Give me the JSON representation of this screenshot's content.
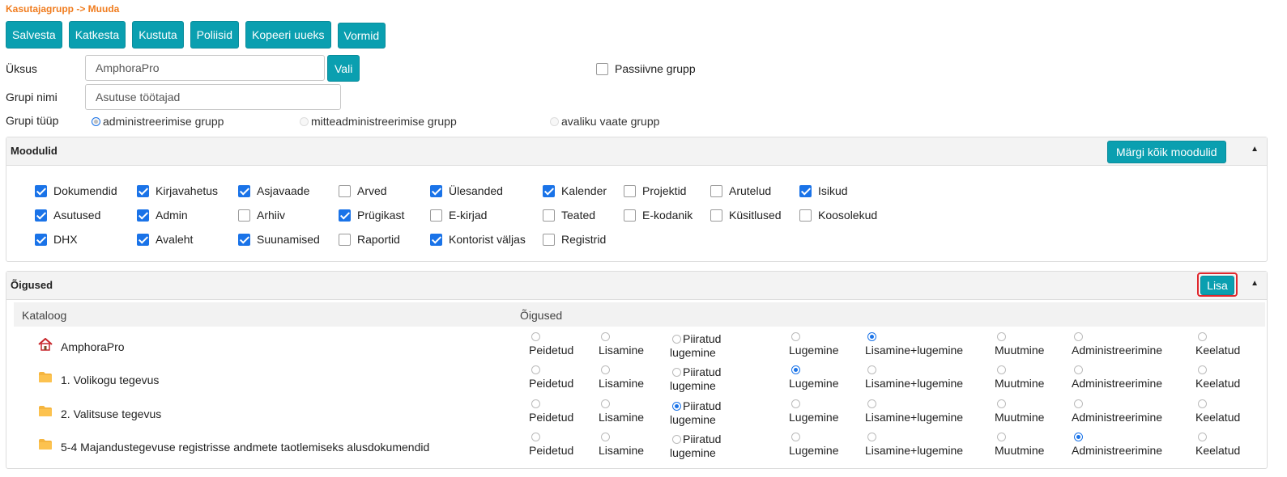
{
  "breadcrumb": "Kasutajagrupp -> Muuda",
  "toolbar": {
    "buttons": [
      "Salvesta",
      "Katkesta",
      "Kustuta",
      "Poliisid",
      "Kopeeri uueks",
      "Vormid"
    ]
  },
  "form": {
    "unit_label": "Üksus",
    "unit_value": "AmphoraPro",
    "choose_label": "Vali",
    "passive_label": "Passiivne grupp",
    "passive_checked": false,
    "name_label": "Grupi nimi",
    "name_value": "Asutuse töötajad",
    "type_label": "Grupi tüüp",
    "types": [
      {
        "label": "administreerimise grupp",
        "checked": true
      },
      {
        "label": "mitteadministreerimise grupp",
        "checked": false
      },
      {
        "label": "avaliku vaate grupp",
        "checked": false
      }
    ]
  },
  "modules": {
    "title": "Moodulid",
    "mark_all_label": "Märgi kõik moodulid",
    "items": [
      {
        "label": "Dokumendid",
        "checked": true
      },
      {
        "label": "Kirjavahetus",
        "checked": true
      },
      {
        "label": "Asjavaade",
        "checked": true
      },
      {
        "label": "Arved",
        "checked": false
      },
      {
        "label": "Ülesanded",
        "checked": true
      },
      {
        "label": "Kalender",
        "checked": true
      },
      {
        "label": "Projektid",
        "checked": false
      },
      {
        "label": "Arutelud",
        "checked": false
      },
      {
        "label": "Isikud",
        "checked": true
      },
      {
        "label": "Asutused",
        "checked": true
      },
      {
        "label": "Admin",
        "checked": true
      },
      {
        "label": "Arhiiv",
        "checked": false
      },
      {
        "label": "Prügikast",
        "checked": true
      },
      {
        "label": "E-kirjad",
        "checked": false
      },
      {
        "label": "Teated",
        "checked": false
      },
      {
        "label": "E-kodanik",
        "checked": false
      },
      {
        "label": "Küsitlused",
        "checked": false
      },
      {
        "label": "Koosolekud",
        "checked": false
      },
      {
        "label": "DHX",
        "checked": true
      },
      {
        "label": "Avaleht",
        "checked": true
      },
      {
        "label": "Suunamised",
        "checked": true
      },
      {
        "label": "Raportid",
        "checked": false
      },
      {
        "label": "Kontorist väljas",
        "checked": true
      },
      {
        "label": "Registrid",
        "checked": false
      }
    ]
  },
  "rights": {
    "title": "Õigused",
    "add_label": "Lisa",
    "col_catalog": "Kataloog",
    "col_rights": "Õigused",
    "options": [
      "Peidetud",
      "Lisamine",
      "Piiratud lugemine",
      "Lugemine",
      "Lisamine+lugemine",
      "Muutmine",
      "Administreerimine",
      "Keelatud"
    ],
    "rows": [
      {
        "name": "AmphoraPro",
        "icon": "home-icon",
        "selected": 4
      },
      {
        "name": "1. Volikogu tegevus",
        "icon": "folder-icon",
        "selected": 3
      },
      {
        "name": "2. Valitsuse tegevus",
        "icon": "folder-icon",
        "selected": 2
      },
      {
        "name": "5-4 Majandustegevuse registrisse andmete taotlemiseks alusdokumendid",
        "icon": "folder-icon",
        "selected": 6
      }
    ]
  },
  "colors": {
    "accent": "#0a9fb0",
    "breadcrumb": "#f07c1e",
    "check": "#1a73e8"
  }
}
